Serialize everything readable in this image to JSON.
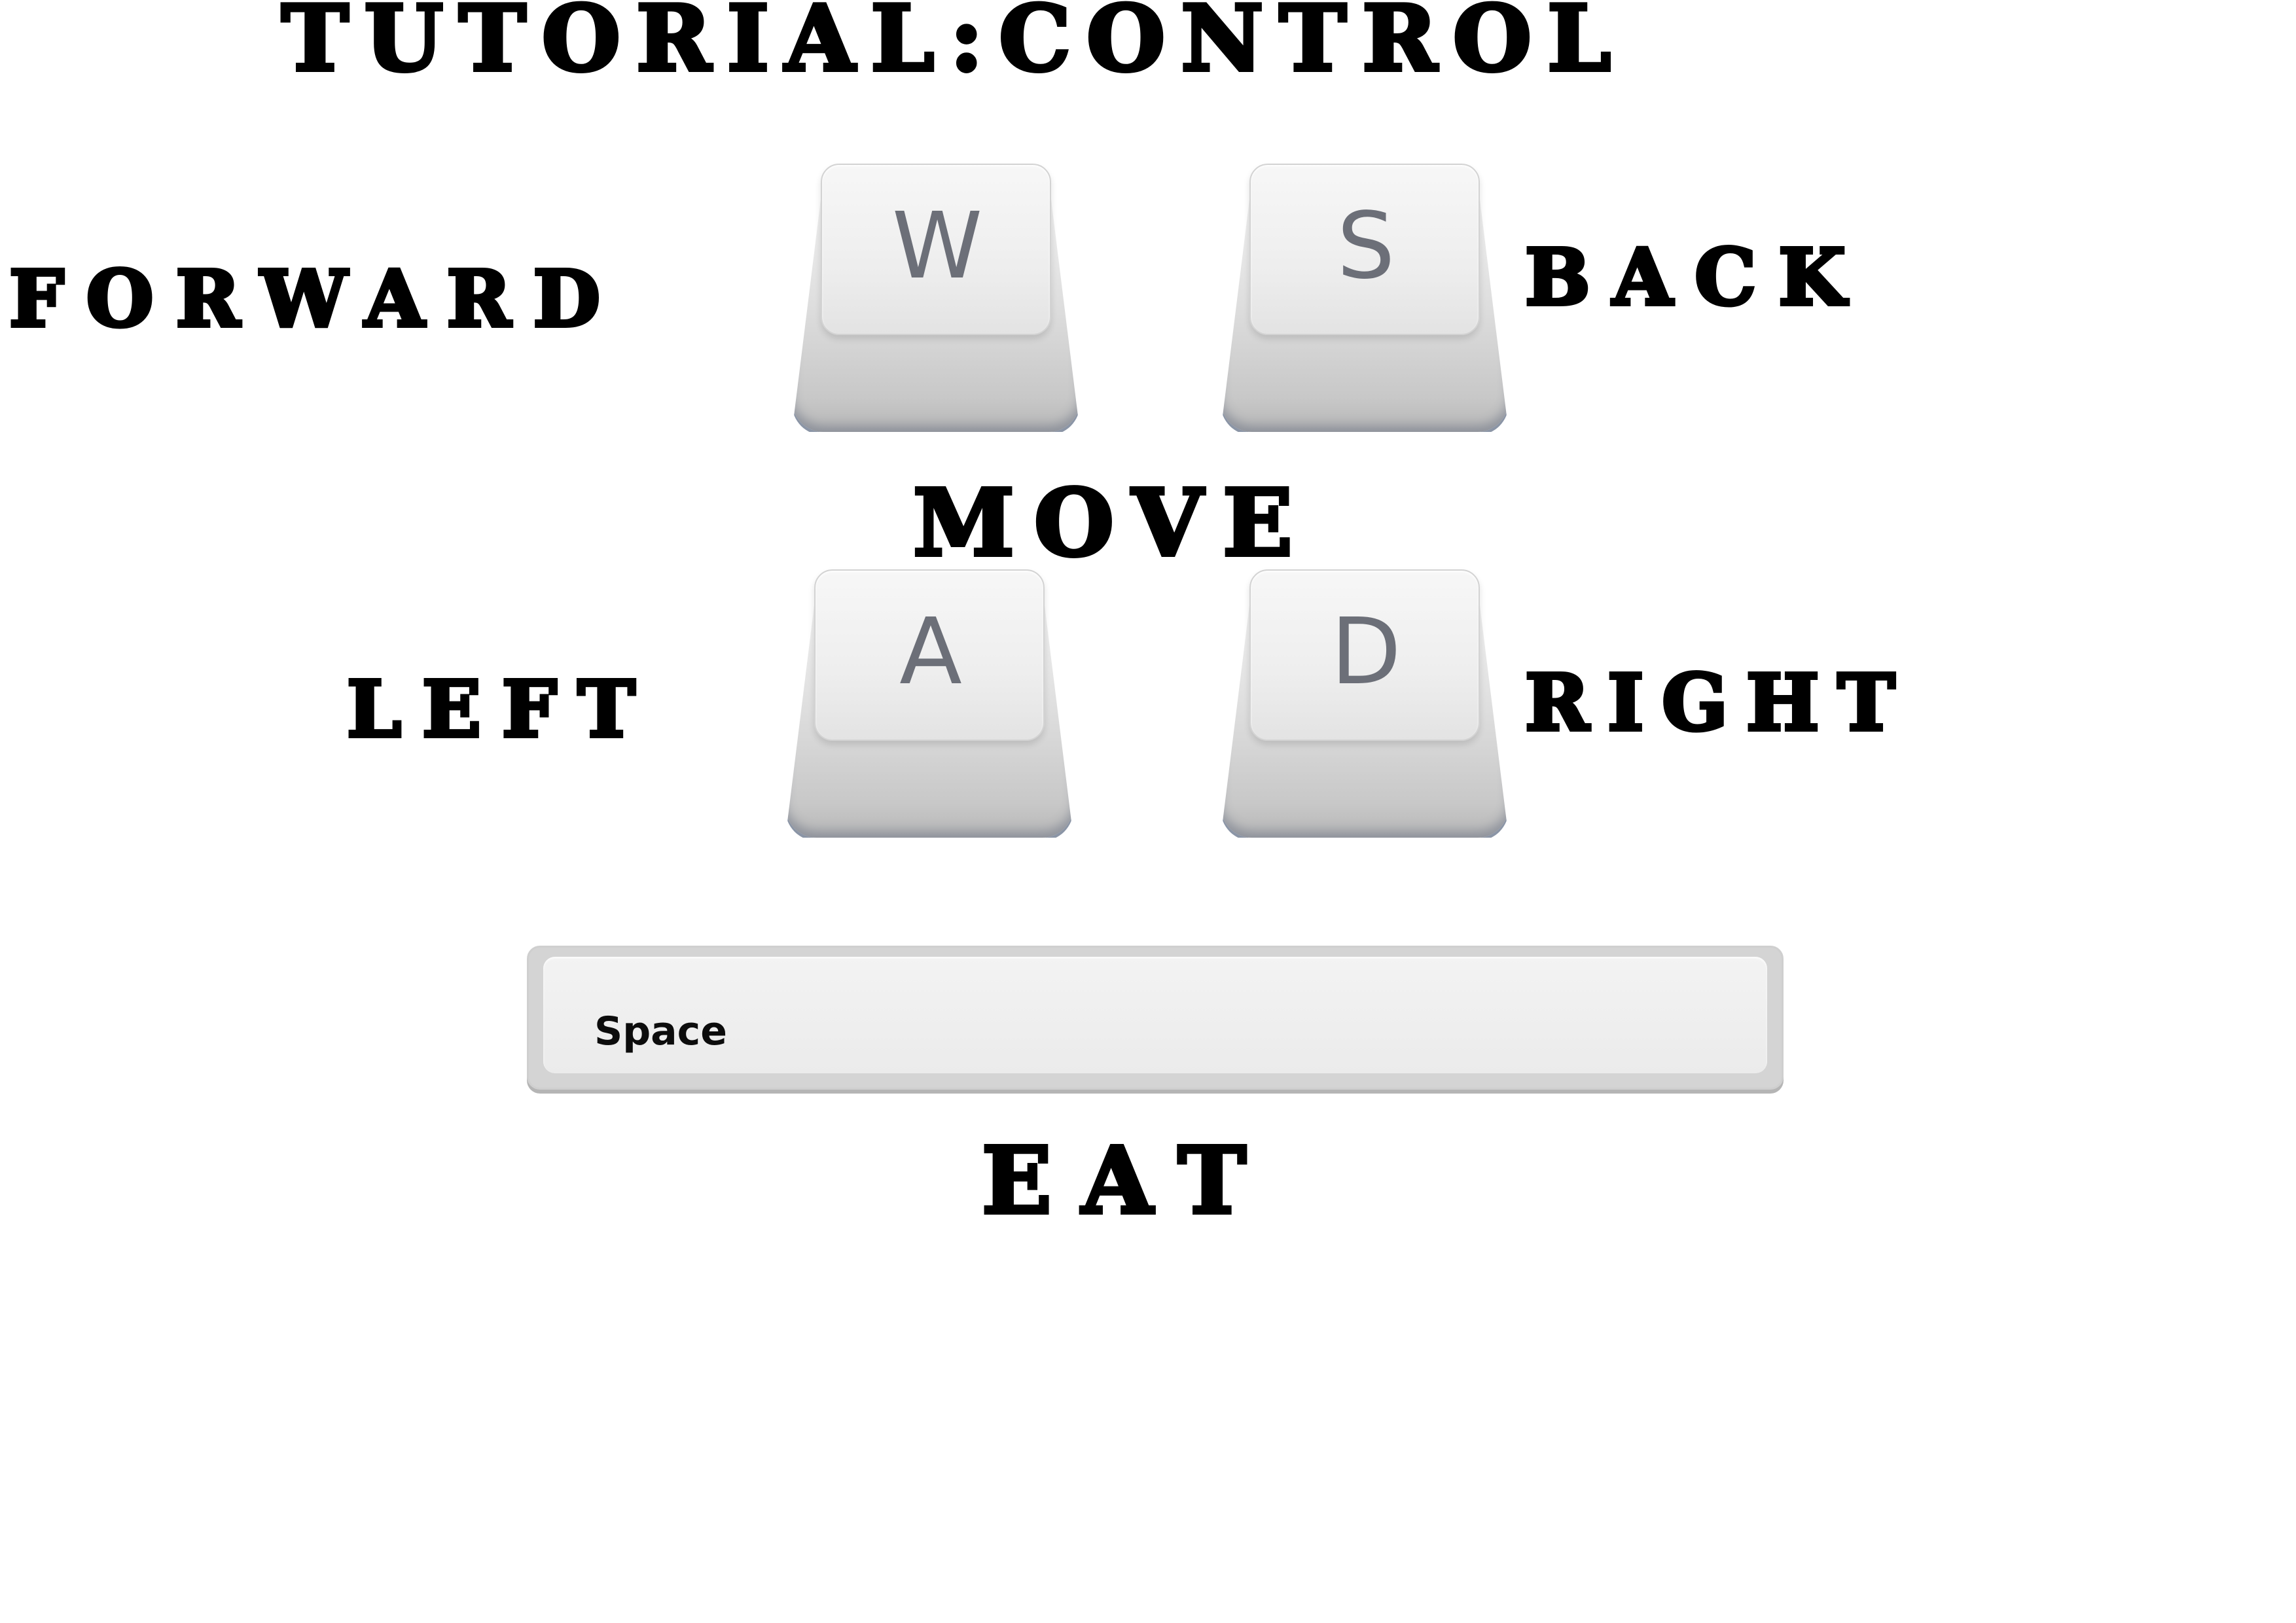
{
  "title": "TUTORIAL:CONTROL",
  "controls": {
    "forward": {
      "label": "FORWARD",
      "key": "W"
    },
    "back": {
      "label": "BACK",
      "key": "S"
    },
    "left": {
      "label": "LEFT",
      "key": "A"
    },
    "right": {
      "label": "RIGHT",
      "key": "D"
    },
    "move_label": "MOVE",
    "eat": {
      "label": "EAT",
      "key": "Space"
    }
  },
  "colors": {
    "text": "#000000",
    "keycap_letter": "#6c6f78",
    "background": "#ffffff"
  }
}
